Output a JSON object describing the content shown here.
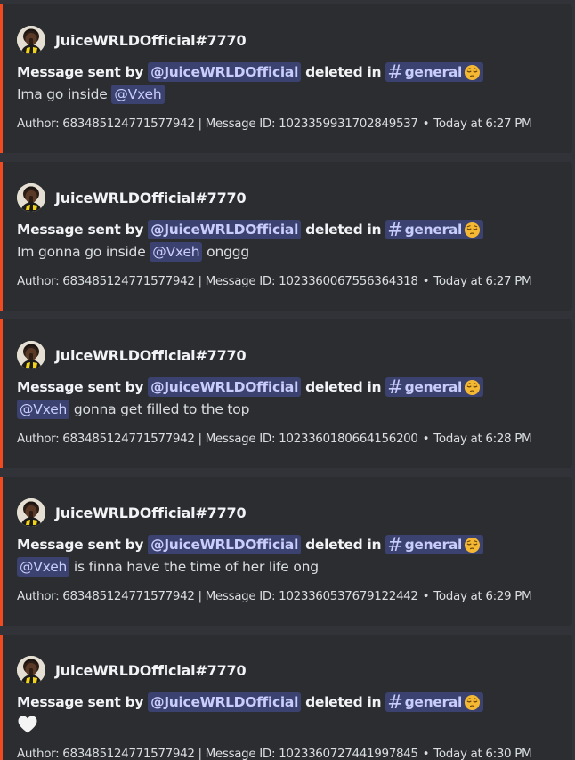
{
  "messages": [
    {
      "author_name": "JuiceWRLDOfficial#7770",
      "title": {
        "prefix": "Message sent by",
        "author_mention": "@JuiceWRLDOfficial",
        "middle": "deleted in",
        "channel_name": "general"
      },
      "description": [
        {
          "kind": "text",
          "value": "Ima go inside "
        },
        {
          "kind": "mention",
          "value": "@Vxeh"
        }
      ],
      "footer": {
        "text": "Author: 683485124771577942 | Message ID: 1023359931702849537",
        "separator": "•",
        "timestamp": "Today at 6:27 PM"
      }
    },
    {
      "author_name": "JuiceWRLDOfficial#7770",
      "title": {
        "prefix": "Message sent by",
        "author_mention": "@JuiceWRLDOfficial",
        "middle": "deleted in",
        "channel_name": "general"
      },
      "description": [
        {
          "kind": "text",
          "value": "Im gonna go inside "
        },
        {
          "kind": "mention",
          "value": "@Vxeh"
        },
        {
          "kind": "text",
          "value": " onggg"
        }
      ],
      "footer": {
        "text": "Author: 683485124771577942 | Message ID: 1023360067556364318",
        "separator": "•",
        "timestamp": "Today at 6:27 PM"
      }
    },
    {
      "author_name": "JuiceWRLDOfficial#7770",
      "title": {
        "prefix": "Message sent by",
        "author_mention": "@JuiceWRLDOfficial",
        "middle": "deleted in",
        "channel_name": "general"
      },
      "description": [
        {
          "kind": "mention",
          "value": "@Vxeh"
        },
        {
          "kind": "text",
          "value": " gonna get filled to the top"
        }
      ],
      "footer": {
        "text": "Author: 683485124771577942 | Message ID: 1023360180664156200",
        "separator": "•",
        "timestamp": "Today at 6:28 PM"
      }
    },
    {
      "author_name": "JuiceWRLDOfficial#7770",
      "title": {
        "prefix": "Message sent by",
        "author_mention": "@JuiceWRLDOfficial",
        "middle": "deleted in",
        "channel_name": "general"
      },
      "description": [
        {
          "kind": "mention",
          "value": "@Vxeh"
        },
        {
          "kind": "text",
          "value": " is finna have the time of her life ong"
        }
      ],
      "footer": {
        "text": "Author: 683485124771577942 | Message ID: 1023360537679122442",
        "separator": "•",
        "timestamp": "Today at 6:29 PM"
      }
    },
    {
      "author_name": "JuiceWRLDOfficial#7770",
      "title": {
        "prefix": "Message sent by",
        "author_mention": "@JuiceWRLDOfficial",
        "middle": "deleted in",
        "channel_name": "general"
      },
      "description": [
        {
          "kind": "emoji",
          "value": "white-heart"
        }
      ],
      "footer": {
        "text": "Author: 683485124771577942 | Message ID: 1023360727441997845",
        "separator": "•",
        "timestamp": "Today at 6:30 PM"
      }
    }
  ],
  "icons": {
    "channel_icon": "hash-icon",
    "channel_emoji": "pensive-face-emoji",
    "avatar": "author-avatar"
  },
  "colors": {
    "embed_accent": "#f04a20",
    "embed_background": "#2b2d31",
    "page_background": "#313338",
    "mention_background": "#3c4270",
    "mention_text": "#c9cdfb"
  }
}
